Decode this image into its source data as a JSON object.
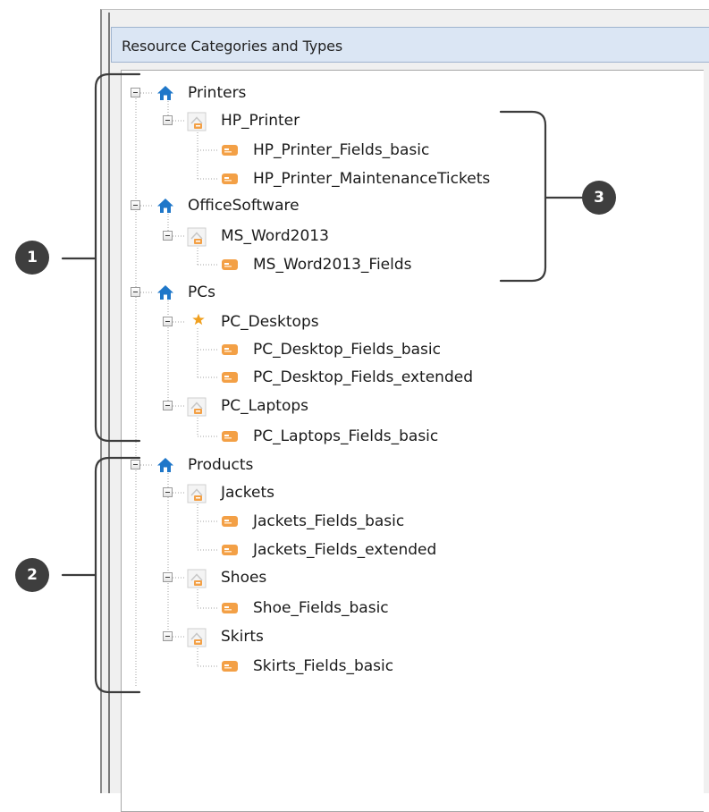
{
  "panel": {
    "title": "Resource Categories and Types"
  },
  "tree": {
    "printers": {
      "label": "Printers",
      "hp_printer": {
        "label": "HP_Printer",
        "fields": [
          "HP_Printer_Fields_basic",
          "HP_Printer_MaintenanceTickets"
        ]
      }
    },
    "office_software": {
      "label": "OfficeSoftware",
      "ms_word": {
        "label": "MS_Word2013",
        "fields": [
          "MS_Word2013_Fields"
        ]
      }
    },
    "pcs": {
      "label": "PCs",
      "pc_desktops": {
        "label": "PC_Desktops",
        "fields": [
          "PC_Desktop_Fields_basic",
          "PC_Desktop_Fields_extended"
        ]
      },
      "pc_laptops": {
        "label": "PC_Laptops",
        "fields": [
          "PC_Laptops_Fields_basic"
        ]
      }
    },
    "products": {
      "label": "Products",
      "jackets": {
        "label": "Jackets",
        "fields": [
          "Jackets_Fields_basic",
          "Jackets_Fields_extended"
        ]
      },
      "shoes": {
        "label": "Shoes",
        "fields": [
          "Shoe_Fields_basic"
        ]
      },
      "skirts": {
        "label": "Skirts",
        "fields": [
          "Skirts_Fields_basic"
        ]
      }
    }
  },
  "callouts": {
    "c1": "1",
    "c2": "2",
    "c3": "3"
  },
  "colors": {
    "category_icon": "#1f77c9",
    "type_icon": "#f3a046",
    "default_star": "#f0a020",
    "callout_bg": "#3e3e3e"
  }
}
